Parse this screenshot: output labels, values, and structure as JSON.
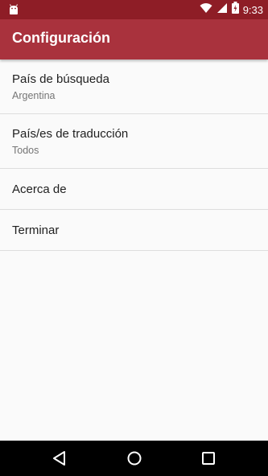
{
  "status_bar": {
    "time": "9:33",
    "icons": [
      "android-icon",
      "wifi-icon",
      "signal-icon",
      "battery-icon"
    ]
  },
  "app_bar": {
    "title": "Configuración"
  },
  "settings": [
    {
      "title": "País de búsqueda",
      "summary": "Argentina"
    },
    {
      "title": "País/es de traducción",
      "summary": "Todos"
    },
    {
      "title": "Acerca de"
    },
    {
      "title": "Terminar"
    }
  ],
  "nav_bar": {
    "icons": [
      "back-icon",
      "home-icon",
      "recents-icon"
    ]
  },
  "colors": {
    "status_bar": "#8e1d26",
    "app_bar": "#a9323d",
    "background": "#fafafa",
    "divider": "#dedede"
  }
}
